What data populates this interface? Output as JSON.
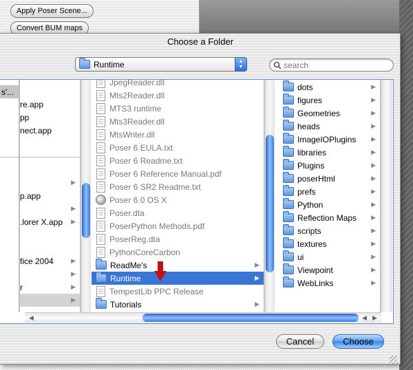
{
  "background_window": {
    "buttons": [
      "Apply Poser Scene...",
      "Convert BUM maps"
    ]
  },
  "dialog": {
    "title": "Choose a Folder",
    "location_popup": "Runtime",
    "search_placeholder": "search"
  },
  "left_stub": {
    "items": [
      "s'...",
      "re.app",
      "pp",
      "nect.app",
      "p.app",
      ".lorer X.app",
      "fice 2004",
      "r"
    ]
  },
  "column1": {
    "items": [
      "JpegReader.dll",
      "Mts2Reader.dll",
      "MTS3 runtime",
      "Mts3Reader.dll",
      "MtsWriter.dll",
      "Poser 6 EULA.txt",
      "Poser 6 Readme.txt",
      "Poser 6 Reference Manual.pdf",
      "Poser 6 SR2 Readme.txt",
      "Poser 6.0 OS X",
      "Poser.dta",
      "PoserPython Methods.pdf",
      "PoserReg.dta",
      "PythonCoreCarbon",
      "ReadMe's",
      "Runtime",
      "TempestLib PPC Release",
      "Tutorials"
    ],
    "selected": "Runtime"
  },
  "column2": {
    "items": [
      "dots",
      "figures",
      "Geometries",
      "heads",
      "ImageIOPlugins",
      "libraries",
      "Plugins",
      "poserHtml",
      "prefs",
      "Python",
      "Reflection Maps",
      "scripts",
      "textures",
      "ui",
      "Viewpoint",
      "WebLinks"
    ]
  },
  "buttons": {
    "cancel": "Cancel",
    "choose": "Choose"
  }
}
